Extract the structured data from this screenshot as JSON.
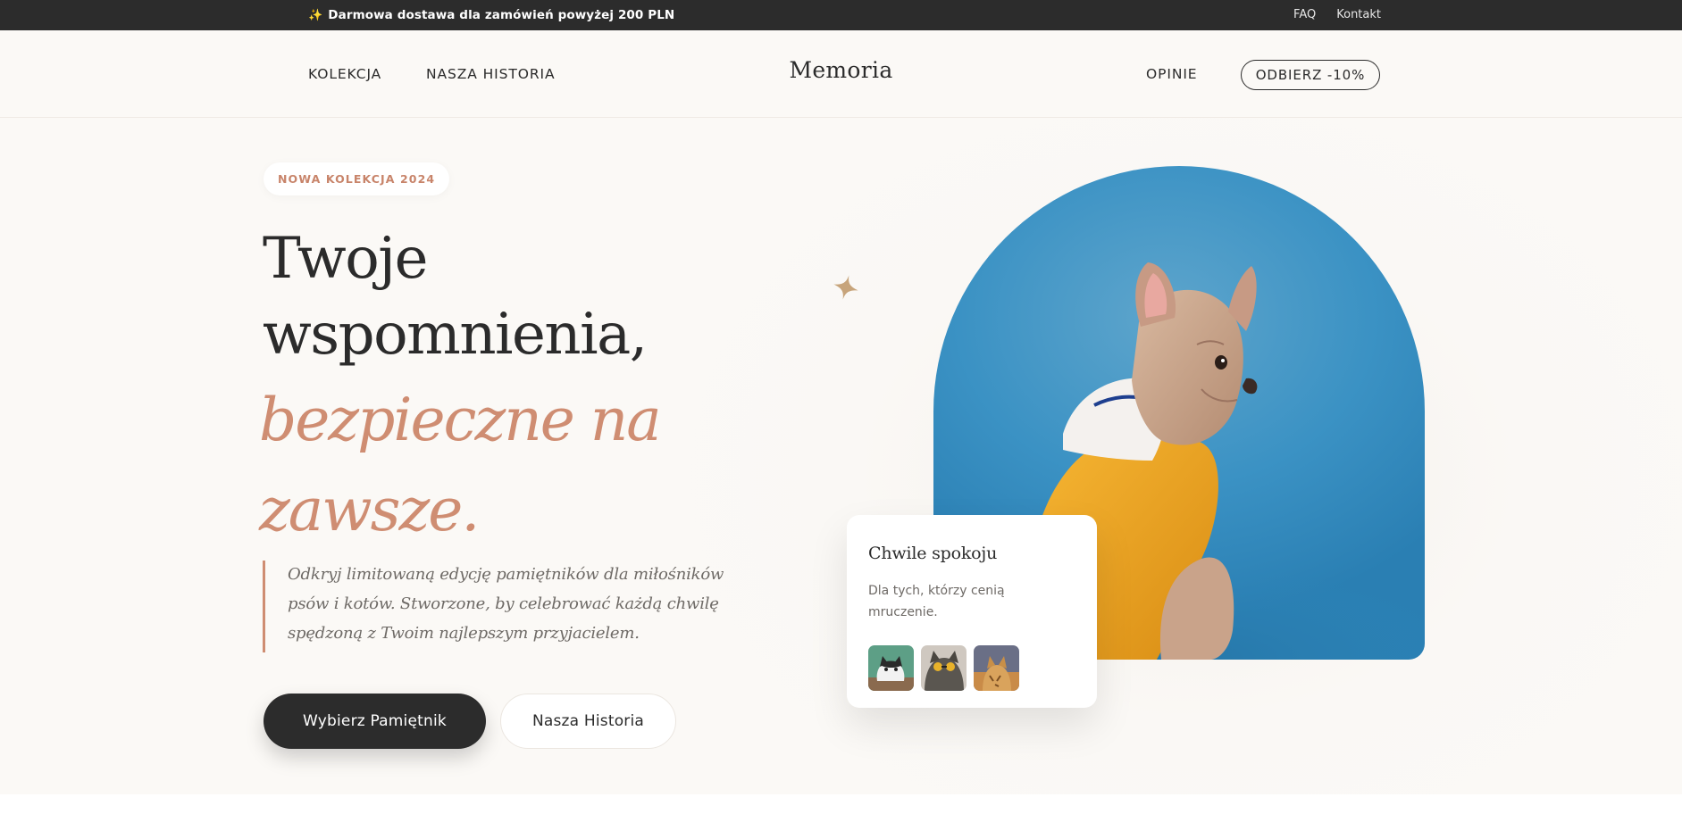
{
  "topbar": {
    "promo_icon": "sparkles-icon",
    "promo_text": "Darmowa dostawa dla zamówień powyżej 200 PLN",
    "links": [
      "FAQ",
      "Kontakt"
    ]
  },
  "nav": {
    "left_links": [
      "KOLEKCJA",
      "NASZA HISTORIA"
    ],
    "logo": "Memoria",
    "right_link": "OPINIE",
    "cta": "ODBIERZ -10%"
  },
  "hero": {
    "badge": "NOWA KOLEKCJA 2024",
    "title_line1": "Twoje",
    "title_line2": "wspomnienia,",
    "title_accent_line1": "bezpieczne na",
    "title_accent_line2": "zawsze.",
    "description": "Odkryj limitowaną edycję pamiętników dla miłośników psów i kotów. Stworzone, by celebrować każdą chwilę spędzoną z Twoim najlepszym przyjacielem.",
    "primary_button": "Wybierz Pamiętnik",
    "secondary_button": "Nasza Historia",
    "decor_icon": "sparkle-star-icon"
  },
  "card": {
    "title": "Chwile spokoju",
    "description": "Dla tych, którzy cenią mruczenie.",
    "thumbnails": [
      "cat-photo",
      "cat-with-glasses-photo",
      "cat-in-sun-photo"
    ]
  },
  "colors": {
    "accent": "#cf8d72",
    "dark": "#2c2c2c",
    "background": "#fbf9f6",
    "photo_blue": "#3b92c4",
    "hoodie_yellow": "#f1a824"
  }
}
